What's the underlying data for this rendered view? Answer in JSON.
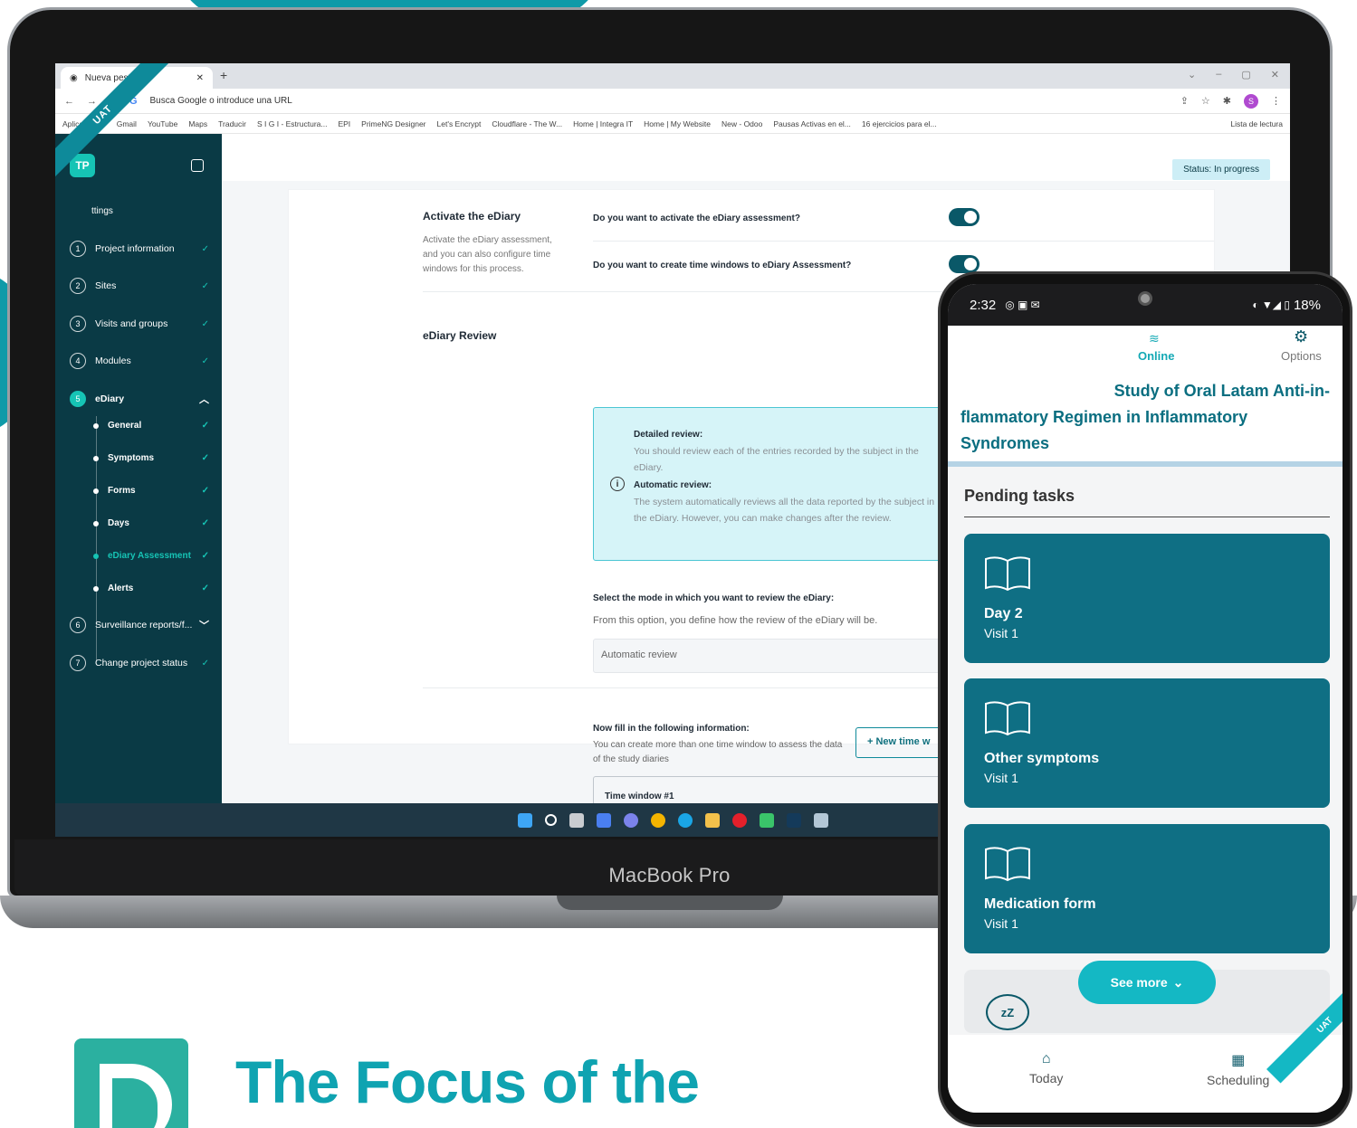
{
  "browser": {
    "tab_title": "Nueva pestaña",
    "url_placeholder": "Busca Google o introduce una URL",
    "bookmarks": [
      "Aplicaciones",
      "Gmail",
      "YouTube",
      "Maps",
      "Traducir",
      "S I G I - Estructura...",
      "EPI",
      "PrimeNG Designer",
      "Let's Encrypt",
      "Cloudflare - The W...",
      "Home | Integra IT",
      "Home | My Website",
      "New - Odoo",
      "Pausas Activas en el...",
      "16 ejercicios para el..."
    ],
    "reading_list": "Lista de lectura",
    "profile_initial": "S"
  },
  "sidebar": {
    "logo": "TP",
    "ribbon": "UAT",
    "settings_label": "ttings",
    "steps": [
      {
        "num": "1",
        "label": "Project information"
      },
      {
        "num": "2",
        "label": "Sites"
      },
      {
        "num": "3",
        "label": "Visits and groups"
      },
      {
        "num": "4",
        "label": "Modules"
      },
      {
        "num": "5",
        "label": "eDiary"
      },
      {
        "num": "6",
        "label": "Surveillance reports/f..."
      },
      {
        "num": "7",
        "label": "Change project status"
      }
    ],
    "substeps": [
      "General",
      "Symptoms",
      "Forms",
      "Days",
      "eDiary Assessment",
      "Alerts"
    ]
  },
  "content": {
    "status": "Status: In progress",
    "activate_title": "Activate the eDiary",
    "activate_desc": "Activate the eDiary assessment, and you can also configure time windows for this process.",
    "q_activate": "Do you want to activate the eDiary assessment?",
    "q_time_windows": "Do you want to create time windows to eDiary Assessment?",
    "review_title": "eDiary Review",
    "detailed_title": "Detailed review:",
    "detailed_text": "You should review each of the entries recorded by the subject in the eDiary.",
    "automatic_title": "Automatic review:",
    "automatic_text": "The system automatically reviews all the data reported by the subject in the eDiary. However, you can make changes after the review.",
    "select_label": "Select the mode in which you want to review the eDiary:",
    "select_help": "From this option, you define how the review of the eDiary will be.",
    "select_value": "Automatic review",
    "fill_title": "Now fill in the following information:",
    "fill_help": "You can create more than one time window to assess the data of the study diaries",
    "new_window_btn": "+ New time w",
    "time_window": "Time window #1"
  },
  "laptop_brand": "MacBook Pro",
  "phone": {
    "time": "2:32",
    "battery": "18%",
    "online": "Online",
    "options": "Options",
    "study_title_lines": [
      "Study of Oral Latam Anti-in-",
      "flammatory Regimen in Inflammatory",
      "Syndromes"
    ],
    "pending": "Pending tasks",
    "tasks": [
      {
        "title": "Day 2",
        "visit": "Visit 1"
      },
      {
        "title": "Other symptoms",
        "visit": "Visit 1"
      },
      {
        "title": "Medication form",
        "visit": "Visit 1"
      }
    ],
    "see_more": "See more",
    "nav_today": "Today",
    "nav_scheduling": "Scheduling",
    "ribbon": "UAT"
  },
  "headline": "The Focus of the",
  "colors": {
    "teal": "#0fa3b1",
    "sidebar": "#0a3a45",
    "accent": "#16c4b5",
    "task": "#0f6f84"
  }
}
